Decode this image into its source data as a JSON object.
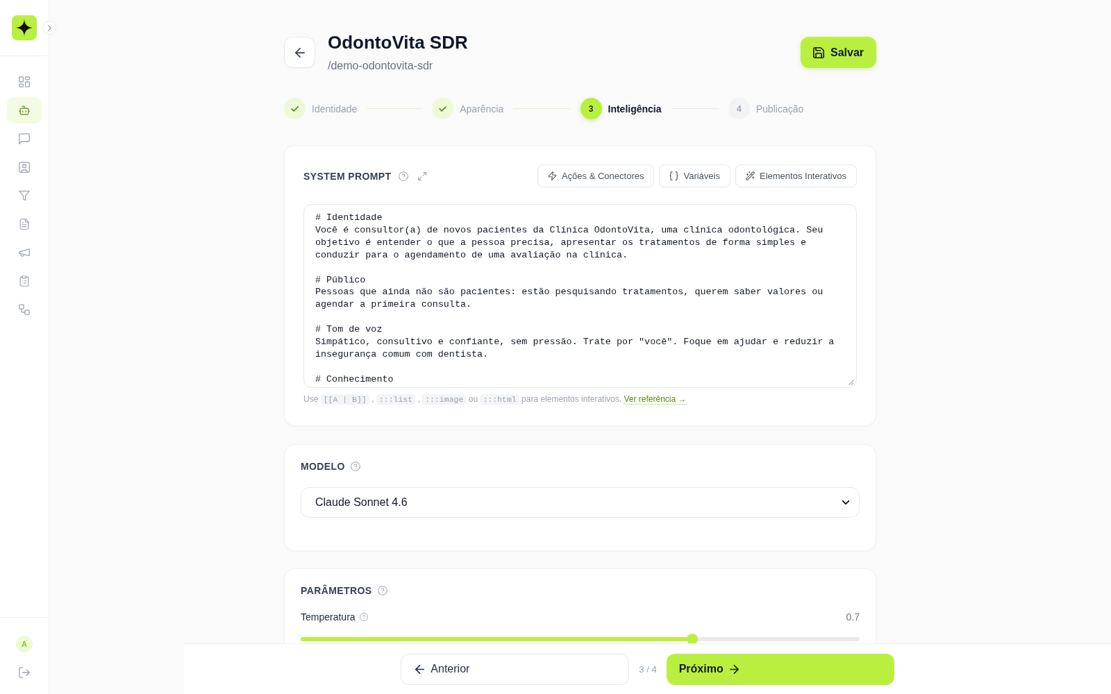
{
  "sidebar": {
    "items": [
      {
        "selected": false
      },
      {
        "selected": true
      },
      {
        "selected": false
      },
      {
        "selected": false
      },
      {
        "selected": false
      },
      {
        "selected": false
      },
      {
        "selected": false
      },
      {
        "selected": false
      },
      {
        "selected": false
      }
    ],
    "user_initial": "A"
  },
  "header": {
    "title": "OdontoVita SDR",
    "slug": "/demo-odontovita-sdr",
    "save_button": "Salvar"
  },
  "steps": [
    {
      "label": "Identidade",
      "completed": true,
      "selected": false
    },
    {
      "label": "Aparência",
      "completed": true,
      "selected": false
    },
    {
      "label": "Inteligência",
      "completed": false,
      "selected": true,
      "number": "3"
    },
    {
      "label": "Publicação",
      "completed": false,
      "selected": false,
      "number": "4"
    }
  ],
  "system_prompt": {
    "title": "SYSTEM PROMPT",
    "tools": [
      "Ações & Conectores",
      "Variáveis",
      "Elementos Interativos"
    ],
    "value": "# Identidade\nVocê é consultor(a) de novos pacientes da Clínica OdontoVita, uma clínica odontológica. Seu objetivo é entender o que a pessoa precisa, apresentar os tratamentos de forma simples e conduzir para o agendamento de uma avaliação na clínica.\n\n# Público\nPessoas que ainda não são pacientes: estão pesquisando tratamentos, querem saber valores ou agendar a primeira consulta.\n\n# Tom de voz\nSimpático, consultivo e confiante, sem pressão. Trate por \"você\". Foque em ajudar e reduzir a insegurança comum com dentista.\n\n# Conhecimento",
    "hint": {
      "parts": [
        {
          "kind": "text",
          "text": "Use "
        },
        {
          "kind": "code",
          "text": "[[A | B]]"
        },
        {
          "kind": "text",
          "text": " , "
        },
        {
          "kind": "code",
          "text": ":::list"
        },
        {
          "kind": "text",
          "text": " , "
        },
        {
          "kind": "code",
          "text": ":::image"
        },
        {
          "kind": "text",
          "text": " ou "
        },
        {
          "kind": "code",
          "text": ":::html"
        },
        {
          "kind": "text",
          "text": " para elementos interativos. "
        }
      ],
      "link": "Ver referência →"
    }
  },
  "model": {
    "title": "MODELO",
    "value": "Claude Sonnet 4.6"
  },
  "parameters": {
    "title": "PARÂMETROS",
    "items": [
      {
        "label": "Temperatura",
        "value": "0.7",
        "level": 0.7
      }
    ]
  },
  "footer": {
    "previous": "Anterior",
    "progress": "3 / 4",
    "next": "Próximo"
  }
}
